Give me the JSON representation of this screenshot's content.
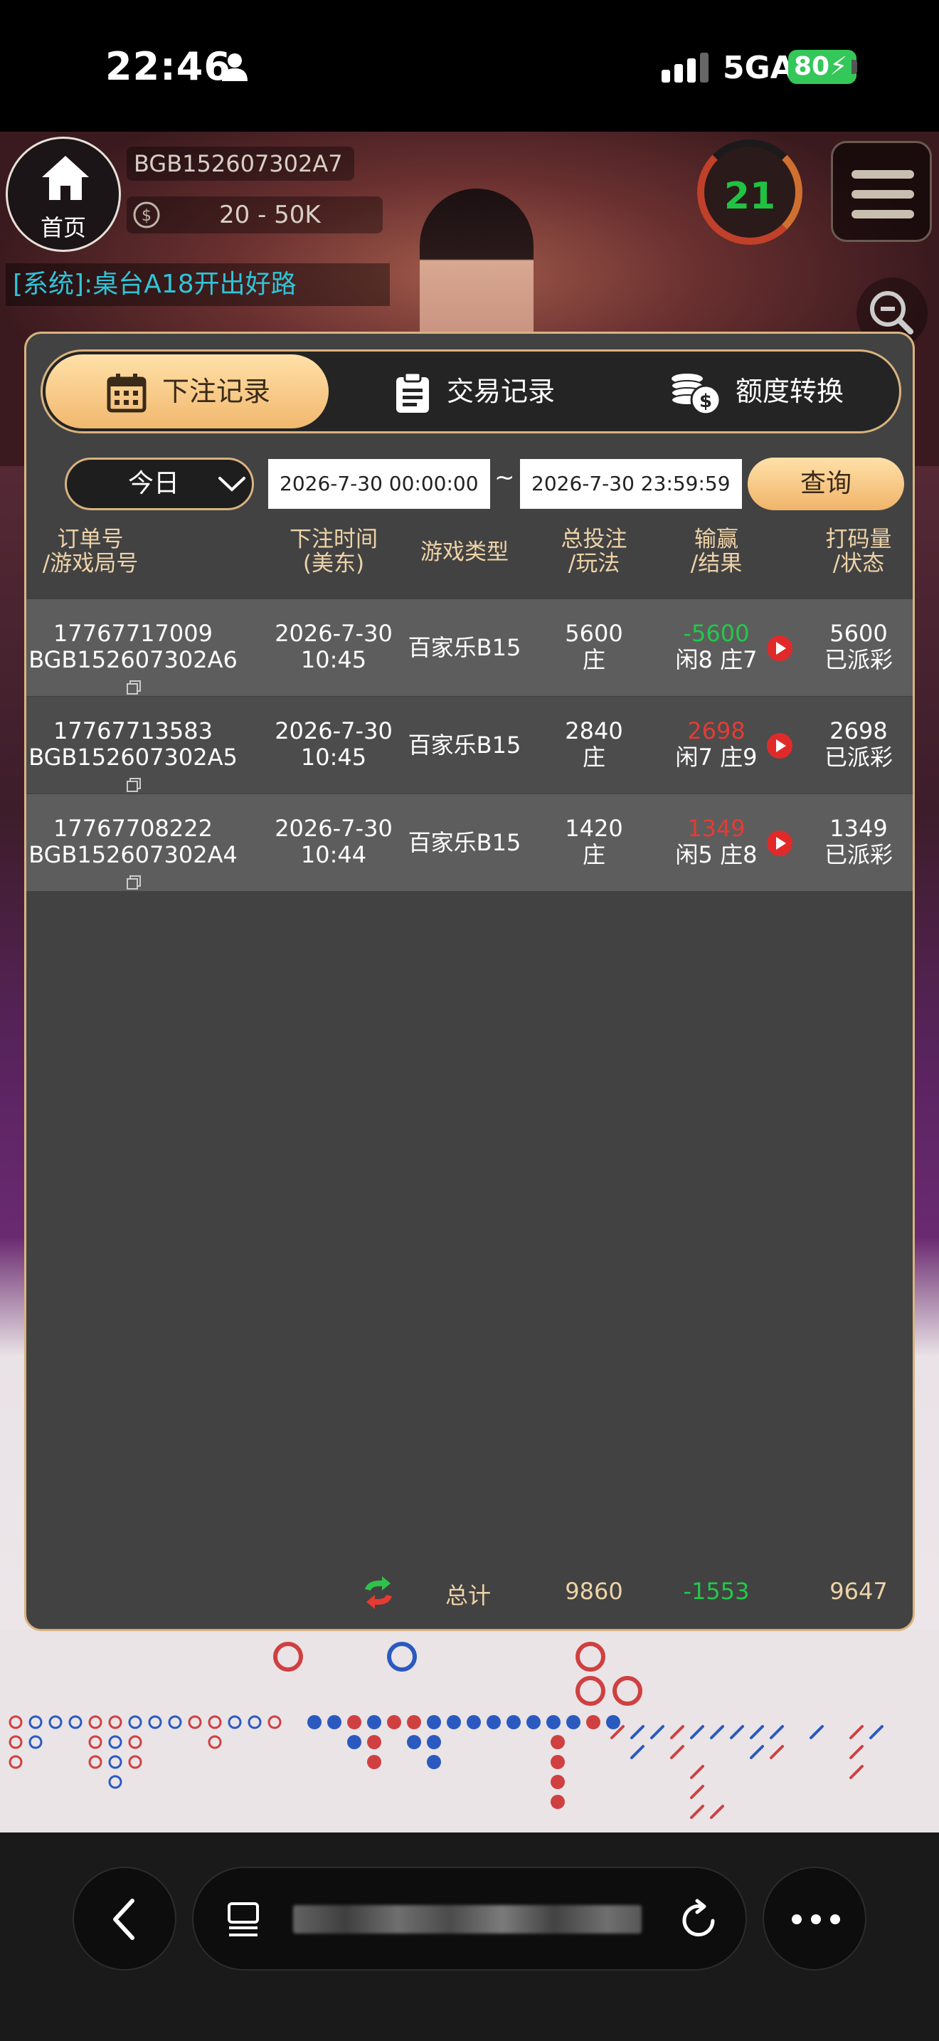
{
  "status_bar": {
    "time": "22:46",
    "network": "5GA",
    "battery": "80"
  },
  "game": {
    "home_label": "首页",
    "table_id": "BGB152607302A7",
    "limit": "20 - 50K",
    "system_message": "[系统]:桌台A18开出好路",
    "countdown": "21"
  },
  "modal": {
    "tabs": [
      {
        "label": "下注记录",
        "icon": "calendar-icon",
        "active": true
      },
      {
        "label": "交易记录",
        "icon": "clipboard-icon",
        "active": false
      },
      {
        "label": "额度转换",
        "icon": "coins-icon",
        "active": false
      }
    ],
    "filter": {
      "period": "今日",
      "start": "2026-7-30 00:00:00",
      "separator": "~",
      "end": "2026-7-30 23:59:59",
      "query_label": "查询"
    },
    "columns": [
      {
        "line1": "订单号",
        "line2": "/游戏局号"
      },
      {
        "line1": "下注时间",
        "line2": "(美东)"
      },
      {
        "line1": "游戏类型",
        "line2": ""
      },
      {
        "line1": "总投注",
        "line2": "/玩法"
      },
      {
        "line1": "输赢",
        "line2": "/结果"
      },
      {
        "line1": "打码量",
        "line2": "/状态"
      }
    ],
    "rows": [
      {
        "order": "17767717009",
        "round": "BGB152607302A6",
        "date": "2026-7-30",
        "time": "10:45",
        "game": "百家乐B15",
        "bet": "5600",
        "play": "庄",
        "win": "-5600",
        "result": "闲8 庄7",
        "turnover": "5600",
        "status": "已派彩"
      },
      {
        "order": "17767713583",
        "round": "BGB152607302A5",
        "date": "2026-7-30",
        "time": "10:45",
        "game": "百家乐B15",
        "bet": "2840",
        "play": "庄",
        "win": "2698",
        "result": "闲7 庄9",
        "turnover": "2698",
        "status": "已派彩"
      },
      {
        "order": "17767708222",
        "round": "BGB152607302A4",
        "date": "2026-7-30",
        "time": "10:44",
        "game": "百家乐B15",
        "bet": "1420",
        "play": "庄",
        "win": "1349",
        "result": "闲5 庄8",
        "turnover": "1349",
        "status": "已派彩"
      }
    ],
    "totals": {
      "label": "总计",
      "bet": "9860",
      "win": "-1553",
      "turnover": "9647"
    }
  },
  "colors": {
    "accent_gold": "#d9b37f",
    "win_positive": "#22c94a",
    "win_negative": "#e53b34"
  }
}
